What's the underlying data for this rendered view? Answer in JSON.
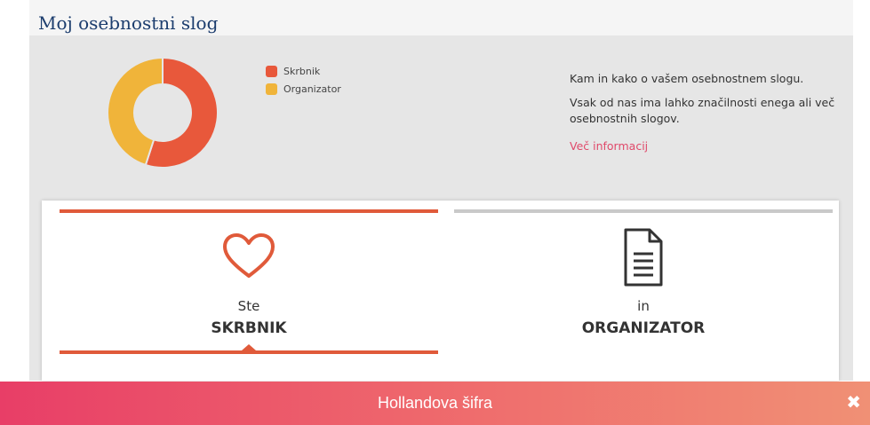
{
  "header": {
    "title": "Moj osebnostni slog"
  },
  "chart_data": {
    "type": "pie",
    "categories": [
      "Skrbnik",
      "Organizator"
    ],
    "values": [
      55,
      45
    ],
    "colors": [
      "#e8583b",
      "#f0b43a"
    ],
    "legend_placement": "right"
  },
  "legend": [
    {
      "label": "Skrbnik",
      "color": "#e8583b"
    },
    {
      "label": "Organizator",
      "color": "#f0b43a"
    }
  ],
  "info": {
    "line1": "Kam in kako o vašem osebnostnem slogu.",
    "line2": "Vsak od nas ima lahko značilnosti enega ali več osebnostnih slogov.",
    "link": "Več informacij",
    "link_color": "#e0496a"
  },
  "tabs": [
    {
      "prefix": "Ste",
      "name": "SKRBNIK",
      "icon": "heart-icon",
      "active": true
    },
    {
      "prefix": "in",
      "name": "ORGANIZATOR",
      "icon": "document-icon",
      "active": false
    }
  ],
  "footer": {
    "label": "Hollandova šifra",
    "close_icon": "close-icon"
  }
}
